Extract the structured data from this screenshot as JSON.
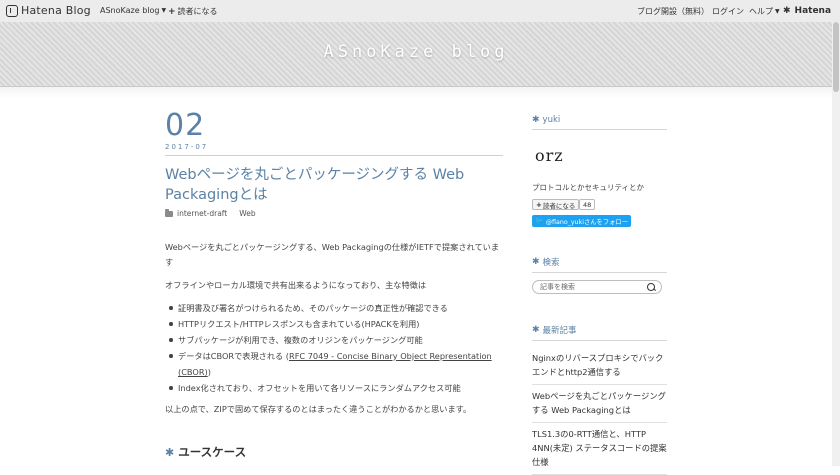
{
  "topbar": {
    "brand": "Hatena Blog",
    "blog_menu": "ASnoKaze blog",
    "reader": "読者になる",
    "open_blog": "ブログ開設（無料）",
    "login": "ログイン",
    "help": "ヘルプ",
    "hatena": "Hatena"
  },
  "header": {
    "title": "ASnoKaze blog"
  },
  "entry": {
    "day": "02",
    "year_month": "2017-07",
    "title": "Webページを丸ごとパッケージングする Web Packagingとは",
    "categories": [
      "internet-draft",
      "Web"
    ],
    "paragraph1": "Webページを丸ごとパッケージングする、Web Packagingの仕様がIETFで提案されています",
    "paragraph2": "オフラインやローカル環境で共有出来るようになっており、主な特徴は",
    "features": [
      "証明書及び署名がつけられるため、そのパッケージの真正性が確認できる",
      "HTTPリクエスト/HTTPレスポンスも含まれている(HPACKを利用)",
      "サブパッケージが利用でき、複数のオリジンをパッケージング可能"
    ],
    "cbor_prefix": "データはCBORで表現される (",
    "cbor_link": "RFC 7049 - Concise Binary Object Representation (CBOR)",
    "cbor_suffix": ")",
    "index_feature": "Index化されており、オフセットを用いて各リソースにランダムアクセス可能",
    "paragraph3": "以上の点で、ZIPで固めて保存するのとはまったく違うことがわかるかと思います。",
    "section_heading": "ユースケース"
  },
  "sidebar": {
    "profile_title": "yuki",
    "avatar_text": "orz",
    "description": "プロトコルとかセキュリティとか",
    "reader_button": "読者になる",
    "reader_count": "48",
    "follow_button": "@flano_yukiさんをフォロー",
    "search_title": "検索",
    "search_placeholder": "記事を検索",
    "recent_title": "最新記事",
    "recent": [
      "Nginxのリバースプロキシでバックエンドとhttp2通信する",
      "Webページを丸ごとパッケージングする Web Packagingとは",
      "TLS1.3の0-RTT通信と、HTTP 4NN(未定) ステータスコードの提案仕様"
    ]
  }
}
